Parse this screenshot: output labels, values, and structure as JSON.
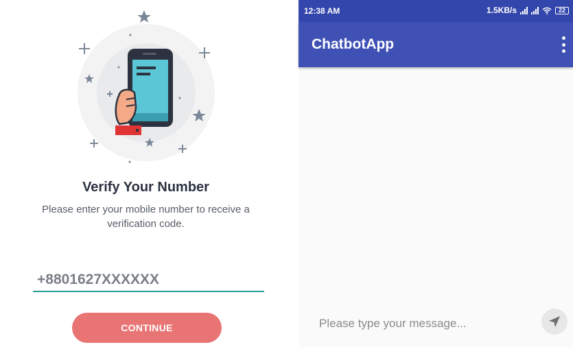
{
  "verify": {
    "title": "Verify Your Number",
    "subtitle": "Please enter your mobile number to receive a verification code.",
    "phone_value": "+8801627XXXXXX",
    "continue_label": "CONTINUE"
  },
  "chat": {
    "status": {
      "time": "12:38 AM",
      "speed": "1.5KB/s",
      "battery": "22"
    },
    "app_title": "ChatbotApp",
    "message_placeholder": "Please type your message...",
    "icons": {
      "menu": "more-vert-icon",
      "send": "send-icon",
      "wifi": "wifi-icon",
      "signal": "signal-icon",
      "battery": "battery-icon"
    }
  },
  "colors": {
    "primary": "#3f51b5",
    "primary_dark": "#3346ab",
    "accent_button": "#e97474",
    "input_underline": "#2a9d94",
    "phone_screen": "#5bc6d6"
  }
}
